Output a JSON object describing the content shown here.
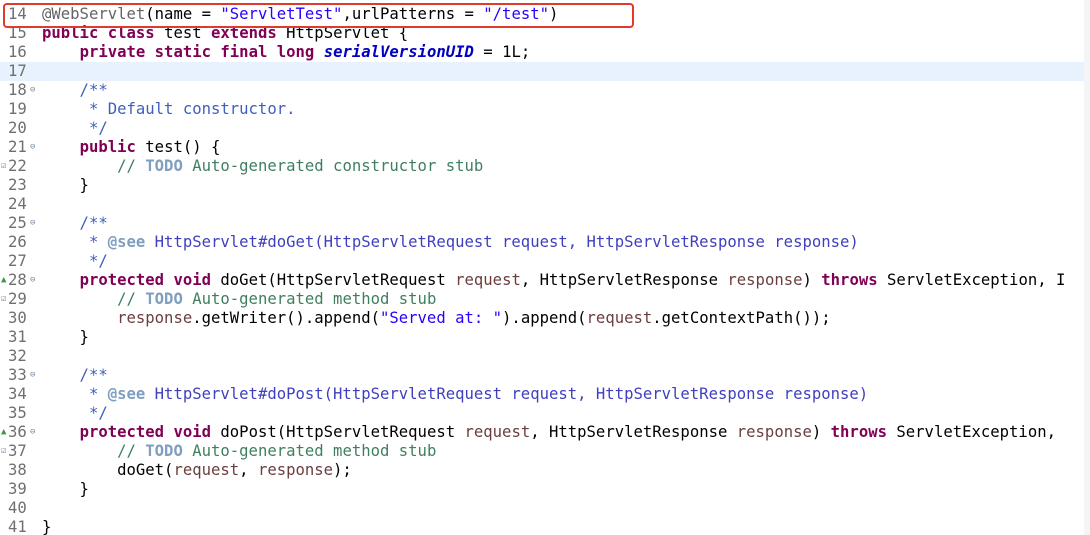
{
  "editor": {
    "highlight_color": "#e03a2e",
    "current_line_color": "#e8f2fe",
    "lines": [
      {
        "num": "14",
        "tokens": [
          {
            "t": "@WebServlet",
            "c": "ann"
          },
          {
            "t": "(name = ",
            "c": ""
          },
          {
            "t": "\"ServletTest\"",
            "c": "str"
          },
          {
            "t": ",urlPatterns = ",
            "c": ""
          },
          {
            "t": "\"/test\"",
            "c": "str"
          },
          {
            "t": ")",
            "c": ""
          }
        ]
      },
      {
        "num": "15",
        "tokens": [
          {
            "t": "public",
            "c": "kw"
          },
          {
            "t": " ",
            "c": ""
          },
          {
            "t": "class",
            "c": "kw"
          },
          {
            "t": " test ",
            "c": ""
          },
          {
            "t": "extends",
            "c": "kw"
          },
          {
            "t": " HttpServlet {",
            "c": ""
          }
        ]
      },
      {
        "num": "16",
        "tokens": [
          {
            "t": "    ",
            "c": ""
          },
          {
            "t": "private",
            "c": "kw"
          },
          {
            "t": " ",
            "c": ""
          },
          {
            "t": "static",
            "c": "kw"
          },
          {
            "t": " ",
            "c": ""
          },
          {
            "t": "final",
            "c": "kw"
          },
          {
            "t": " ",
            "c": ""
          },
          {
            "t": "long",
            "c": "kw"
          },
          {
            "t": " ",
            "c": ""
          },
          {
            "t": "serialVersionUID",
            "c": "field"
          },
          {
            "t": " = 1L;",
            "c": ""
          }
        ]
      },
      {
        "num": "17",
        "current": true,
        "tokens": []
      },
      {
        "num": "18",
        "fold": true,
        "tokens": [
          {
            "t": "    /**",
            "c": "jd"
          }
        ]
      },
      {
        "num": "19",
        "tokens": [
          {
            "t": "     * Default constructor.",
            "c": "jd"
          }
        ]
      },
      {
        "num": "20",
        "tokens": [
          {
            "t": "     */",
            "c": "jd"
          }
        ]
      },
      {
        "num": "21",
        "fold": true,
        "tokens": [
          {
            "t": "    ",
            "c": ""
          },
          {
            "t": "public",
            "c": "kw"
          },
          {
            "t": " test() {",
            "c": ""
          }
        ]
      },
      {
        "num": "22",
        "marker": "todo",
        "tokens": [
          {
            "t": "        // ",
            "c": "cm"
          },
          {
            "t": "TODO",
            "c": "todo"
          },
          {
            "t": " Auto-generated constructor stub",
            "c": "cm"
          }
        ]
      },
      {
        "num": "23",
        "tokens": [
          {
            "t": "    }",
            "c": ""
          }
        ]
      },
      {
        "num": "24",
        "tokens": []
      },
      {
        "num": "25",
        "fold": true,
        "tokens": [
          {
            "t": "    /**",
            "c": "jd"
          }
        ]
      },
      {
        "num": "26",
        "tokens": [
          {
            "t": "     * ",
            "c": "jd"
          },
          {
            "t": "@see",
            "c": "jdtag"
          },
          {
            "t": " HttpServlet#doGet(HttpServletRequest request, HttpServletResponse response)",
            "c": "jdref"
          }
        ]
      },
      {
        "num": "27",
        "tokens": [
          {
            "t": "     */",
            "c": "jd"
          }
        ]
      },
      {
        "num": "28",
        "fold": true,
        "marker": "override",
        "tokens": [
          {
            "t": "    ",
            "c": ""
          },
          {
            "t": "protected",
            "c": "kw"
          },
          {
            "t": " ",
            "c": ""
          },
          {
            "t": "void",
            "c": "kw"
          },
          {
            "t": " doGet(HttpServletRequest ",
            "c": ""
          },
          {
            "t": "request",
            "c": "param"
          },
          {
            "t": ", HttpServletResponse ",
            "c": ""
          },
          {
            "t": "response",
            "c": "param"
          },
          {
            "t": ") ",
            "c": ""
          },
          {
            "t": "throws",
            "c": "kw"
          },
          {
            "t": " ServletException, I",
            "c": ""
          }
        ]
      },
      {
        "num": "29",
        "marker": "todo",
        "tokens": [
          {
            "t": "        // ",
            "c": "cm"
          },
          {
            "t": "TODO",
            "c": "todo"
          },
          {
            "t": " Auto-generated method stub",
            "c": "cm"
          }
        ]
      },
      {
        "num": "30",
        "tokens": [
          {
            "t": "        ",
            "c": ""
          },
          {
            "t": "response",
            "c": "param"
          },
          {
            "t": ".getWriter().append(",
            "c": ""
          },
          {
            "t": "\"Served at: \"",
            "c": "str"
          },
          {
            "t": ").append(",
            "c": ""
          },
          {
            "t": "request",
            "c": "param"
          },
          {
            "t": ".getContextPath());",
            "c": ""
          }
        ]
      },
      {
        "num": "31",
        "tokens": [
          {
            "t": "    }",
            "c": ""
          }
        ]
      },
      {
        "num": "32",
        "tokens": []
      },
      {
        "num": "33",
        "fold": true,
        "tokens": [
          {
            "t": "    /**",
            "c": "jd"
          }
        ]
      },
      {
        "num": "34",
        "tokens": [
          {
            "t": "     * ",
            "c": "jd"
          },
          {
            "t": "@see",
            "c": "jdtag"
          },
          {
            "t": " HttpServlet#doPost(HttpServletRequest request, HttpServletResponse response)",
            "c": "jdref"
          }
        ]
      },
      {
        "num": "35",
        "tokens": [
          {
            "t": "     */",
            "c": "jd"
          }
        ]
      },
      {
        "num": "36",
        "fold": true,
        "marker": "override",
        "tokens": [
          {
            "t": "    ",
            "c": ""
          },
          {
            "t": "protected",
            "c": "kw"
          },
          {
            "t": " ",
            "c": ""
          },
          {
            "t": "void",
            "c": "kw"
          },
          {
            "t": " doPost(HttpServletRequest ",
            "c": ""
          },
          {
            "t": "request",
            "c": "param"
          },
          {
            "t": ", HttpServletResponse ",
            "c": ""
          },
          {
            "t": "response",
            "c": "param"
          },
          {
            "t": ") ",
            "c": ""
          },
          {
            "t": "throws",
            "c": "kw"
          },
          {
            "t": " ServletException, ",
            "c": ""
          }
        ]
      },
      {
        "num": "37",
        "marker": "todo",
        "tokens": [
          {
            "t": "        // ",
            "c": "cm"
          },
          {
            "t": "TODO",
            "c": "todo"
          },
          {
            "t": " Auto-generated method stub",
            "c": "cm"
          }
        ]
      },
      {
        "num": "38",
        "tokens": [
          {
            "t": "        doGet(",
            "c": ""
          },
          {
            "t": "request",
            "c": "param"
          },
          {
            "t": ", ",
            "c": ""
          },
          {
            "t": "response",
            "c": "param"
          },
          {
            "t": ");",
            "c": ""
          }
        ]
      },
      {
        "num": "39",
        "tokens": [
          {
            "t": "    }",
            "c": ""
          }
        ]
      },
      {
        "num": "40",
        "tokens": []
      },
      {
        "num": "41",
        "tokens": [
          {
            "t": "}",
            "c": ""
          }
        ]
      }
    ]
  }
}
